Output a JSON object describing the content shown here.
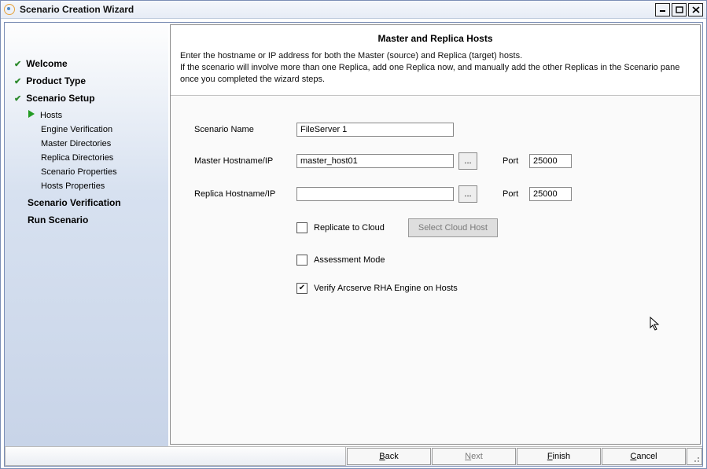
{
  "title": "Scenario Creation Wizard",
  "nav": {
    "completed": [
      "Welcome",
      "Product Type",
      "Scenario Setup"
    ],
    "subs": {
      "current": "Hosts",
      "others": [
        "Engine Verification",
        "Master Directories",
        "Replica Directories",
        "Scenario Properties",
        "Hosts Properties"
      ]
    },
    "pending": [
      "Scenario Verification",
      "Run Scenario"
    ]
  },
  "header": {
    "title": "Master and Replica Hosts",
    "desc1": "Enter the hostname or IP address for both the Master (source) and Replica (target) hosts.",
    "desc2": "If the scenario will involve more than one Replica, add one Replica now, and manually add the other Replicas in the Scenario pane once you completed the wizard steps."
  },
  "form": {
    "scenarioLabel": "Scenario Name",
    "scenarioValue": "FileServer 1",
    "masterLabel": "Master Hostname/IP",
    "masterValue": "master_host01",
    "masterPortLabel": "Port",
    "masterPortValue": "25000",
    "replicaLabel": "Replica Hostname/IP",
    "replicaValue": "",
    "replicaPortLabel": "Port",
    "replicaPortValue": "25000",
    "browse": "...",
    "replicateCloud": "Replicate to Cloud",
    "selectCloud": "Select Cloud Host",
    "assessment": "Assessment Mode",
    "verifyEngine": "Verify Arcserve RHA Engine on Hosts"
  },
  "footer": {
    "back": {
      "u": "B",
      "rest": "ack"
    },
    "next": {
      "u": "N",
      "rest": "ext"
    },
    "finish": {
      "u": "F",
      "rest": "inish"
    },
    "cancel": {
      "u": "C",
      "rest": "ancel"
    }
  }
}
